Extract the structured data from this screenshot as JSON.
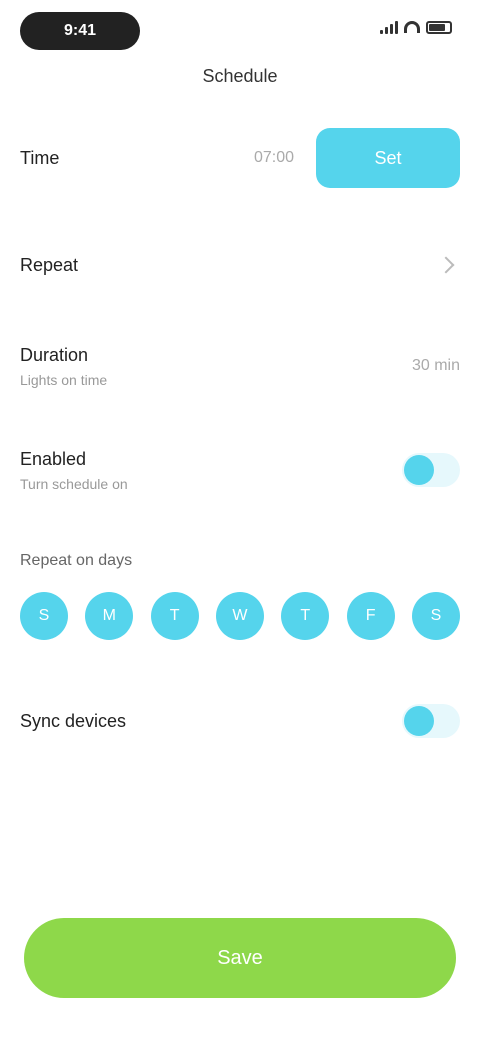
{
  "status_bar": {
    "time": "9:41"
  },
  "header": {
    "title": "Schedule"
  },
  "time_setting": {
    "label": "Time",
    "value": "07:00",
    "button_label": "Set"
  },
  "repeat": {
    "label": "Repeat"
  },
  "duration": {
    "label": "Duration",
    "sub": "Lights on time",
    "value": "30 min"
  },
  "enabled": {
    "label": "Enabled",
    "sub": "Turn schedule on",
    "on": true
  },
  "days": {
    "title": "Repeat on days",
    "items": [
      "S",
      "M",
      "T",
      "W",
      "T",
      "F",
      "S"
    ]
  },
  "sync": {
    "label": "Sync devices",
    "on": true
  },
  "footer": {
    "save_label": "Save"
  },
  "colors": {
    "accent": "#55d4ec",
    "save": "#8ed84a"
  }
}
